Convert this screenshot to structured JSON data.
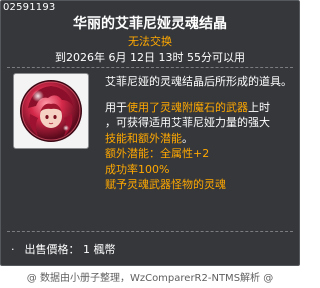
{
  "tooltip": {
    "item_id": "02591193",
    "item_name": "华丽的艾菲尼娅灵魂结晶",
    "tradability": "无法交换",
    "expiry": "到2026年 6月 12日 13时 55分可以用",
    "icon": "soul-crystal-icon",
    "description": {
      "line1": "艾菲尼娅的灵魂结晶后所形成的道具。",
      "line2_part1": "用于",
      "line2_part2": "使用了灵魂附魔石的武器",
      "line2_part3": "上时",
      "line3": "，可获得适用艾菲尼娅力量的强大",
      "line4": "技能和额外潜能",
      "line4_tail": "。",
      "line5": "额外潜能：全属性+2",
      "line6": "成功率100%",
      "line7": "赋予灵魂武器怪物的灵魂"
    },
    "price_label": "出售價格：",
    "price_value": "1 楓幣",
    "bullet": "·"
  },
  "footer": {
    "text": "@ 数据由小册子整理，WzComparerR2-NTMS解析 @"
  },
  "colors": {
    "background": "#35373b",
    "accent": "#ffa800",
    "text": "#ffffff",
    "footer": "#606060"
  }
}
